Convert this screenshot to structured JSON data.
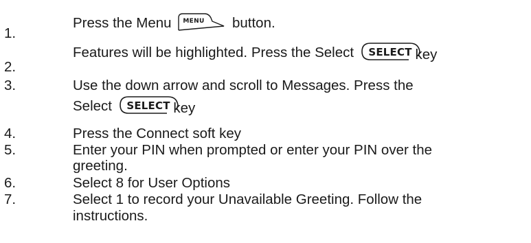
{
  "steps": [
    {
      "number": "1.",
      "line1_before": "Press the Menu",
      "key": {
        "label": "MENU",
        "icon": "menu-key-icon"
      },
      "line1_after": "button."
    },
    {
      "number": "2.",
      "line1_before": "Features will be highlighted.  Press the Select",
      "key": {
        "label": "SELECT",
        "icon": "select-key-icon"
      },
      "line1_after": "key"
    },
    {
      "number": "3.",
      "line1": "Use the down arrow and scroll to Messages.  Press the",
      "line2_before": "Select",
      "key": {
        "label": "SELECT",
        "icon": "select-key-icon"
      },
      "line2_after": "key"
    },
    {
      "number": "4.",
      "line1": "Press the Connect soft key"
    },
    {
      "number": "5.",
      "line1": "Enter your PIN when prompted or enter your PIN over the",
      "line2": "greeting."
    },
    {
      "number": "6.",
      "line1": "Select 8 for User Options"
    },
    {
      "number": "7.",
      "line1": "Select 1 to record your Unavailable Greeting.  Follow the",
      "line2": "instructions."
    }
  ]
}
